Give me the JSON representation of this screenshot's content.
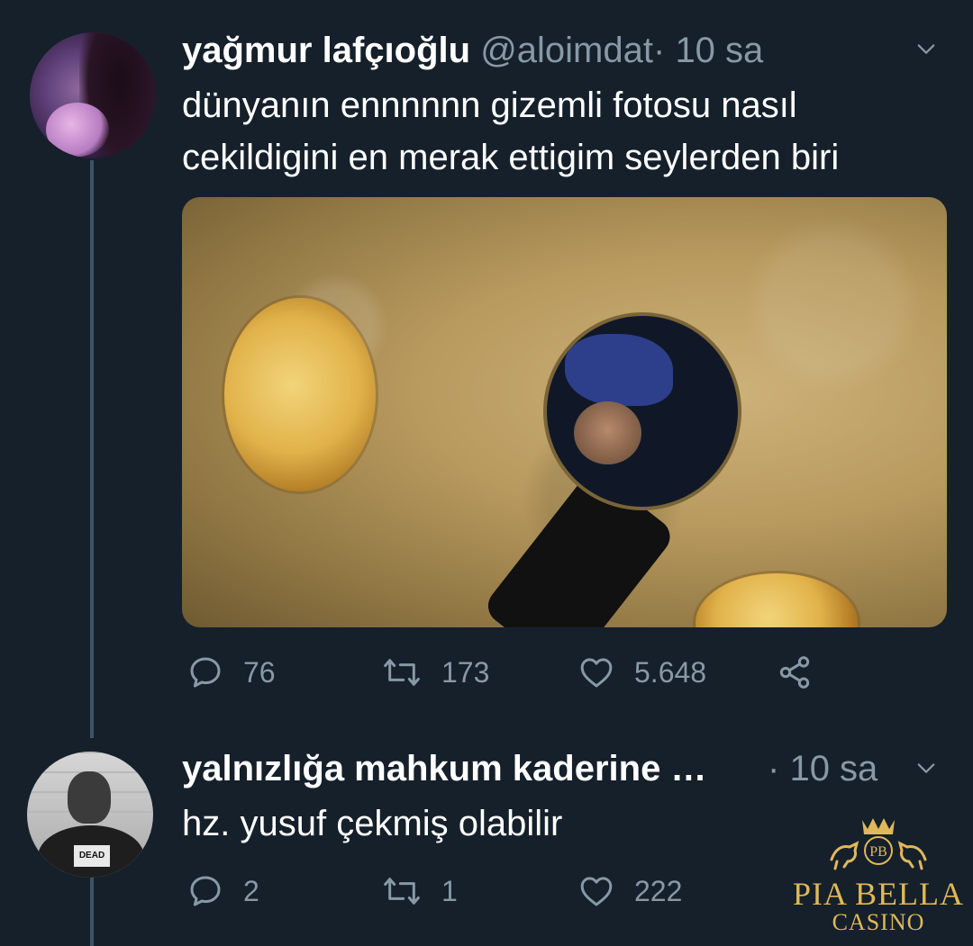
{
  "tweet": {
    "author_name": "yağmur lafçıoğlu",
    "author_handle": "@aloimdat",
    "separator": "·",
    "time": "10 sa",
    "text_line1": "dünyanın ennnnnn gizemli fotosu nasıl",
    "text_line2": "cekildigini en merak ettigim seylerden biri",
    "media_description": "Photo looking down into a tandoor oven with breads on the walls",
    "stats": {
      "replies": "76",
      "retweets": "173",
      "likes": "5.648"
    }
  },
  "reply": {
    "author_name": "yalnızlığa mahkum kaderine …",
    "separator": "·",
    "time": "10 sa",
    "text": "hz. yusuf çekmiş olabilir",
    "avatar_sign": "DEAD",
    "stats": {
      "replies": "2",
      "retweets": "1",
      "likes": "222"
    }
  },
  "watermark": {
    "monogram": "PB",
    "brand": "PIA BELLA",
    "sub": "CASINO"
  },
  "colors": {
    "background": "#15202b",
    "primary_text": "#ffffff",
    "secondary_text": "#8899a6",
    "thread_line": "#3d5466",
    "watermark_gold": "#e0b85a"
  },
  "icons": [
    "reply-icon",
    "retweet-icon",
    "like-icon",
    "share-icon",
    "chevron-down-icon"
  ]
}
